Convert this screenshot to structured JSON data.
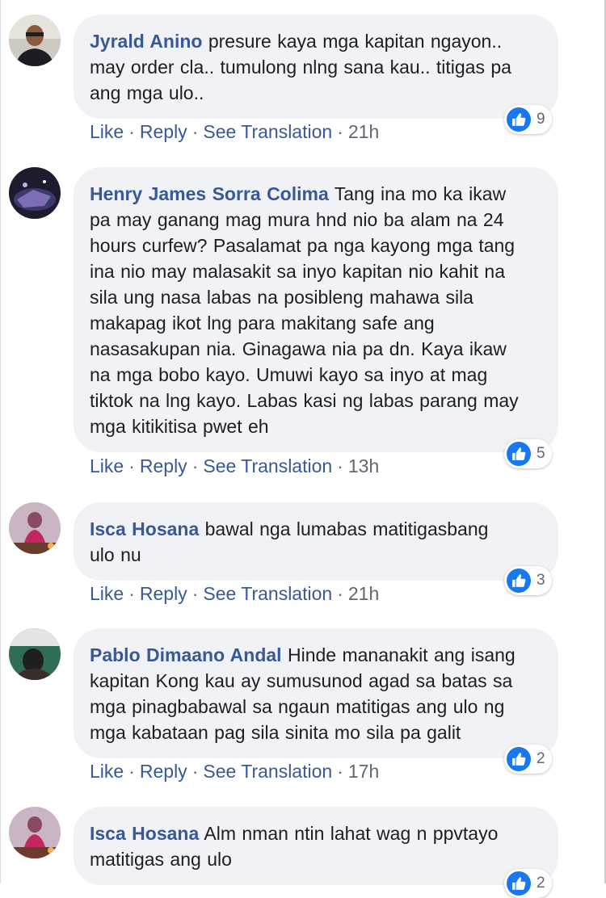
{
  "actions": {
    "like": "Like",
    "reply": "Reply",
    "translate": "See Translation",
    "separator": "·"
  },
  "comments": [
    {
      "author": "Jyrald Anino",
      "lines": [
        "presure kaya mga kapitan ngayon..",
        "may order cla.. tumulong nlng sana kau.. titigas pa",
        "ang mga ulo.."
      ],
      "reactions": "9",
      "time": "21h"
    },
    {
      "author": "Henry James Sorra Colima",
      "lines": [
        "Tang ina mo ka ikaw",
        "pa may ganang mag mura hnd nio ba alam na 24",
        "hours curfew? Pasalamat pa nga kayong mga tang",
        "ina nio may malasakit sa inyo kapitan nio kahit na",
        "sila ung nasa labas na posibleng mahawa sila",
        "makapag ikot lng para makitang safe ang",
        "nasasakupan nia. Ginagawa nia pa dn. Kaya ikaw",
        "na mga bobo kayo. Umuwi kayo sa inyo at mag",
        "tiktok na lng kayo. Labas kasi ng labas parang may",
        "mga kitikitisa pwet eh"
      ],
      "reactions": "5",
      "time": "13h"
    },
    {
      "author": "Isca Hosana",
      "lines": [
        "bawal nga lumabas matitigasbang",
        "ulo nu"
      ],
      "reactions": "3",
      "time": "21h"
    },
    {
      "author": "Pablo Dimaano Andal",
      "lines": [
        "Hinde mananakit ang isang",
        "kapitan Kong kau ay sumusunod agad sa batas sa",
        "mga pinagbabawal sa ngaun matitigas ang ulo ng",
        "mga kabataan pag sila sinita mo sila pa galit"
      ],
      "reactions": "2",
      "time": "17h"
    },
    {
      "author": "Isca Hosana",
      "lines": [
        "Alm nman ntin lahat wag n ppvtayo",
        "matitigas ang ulo"
      ],
      "reactions": "2",
      "time": ""
    }
  ]
}
